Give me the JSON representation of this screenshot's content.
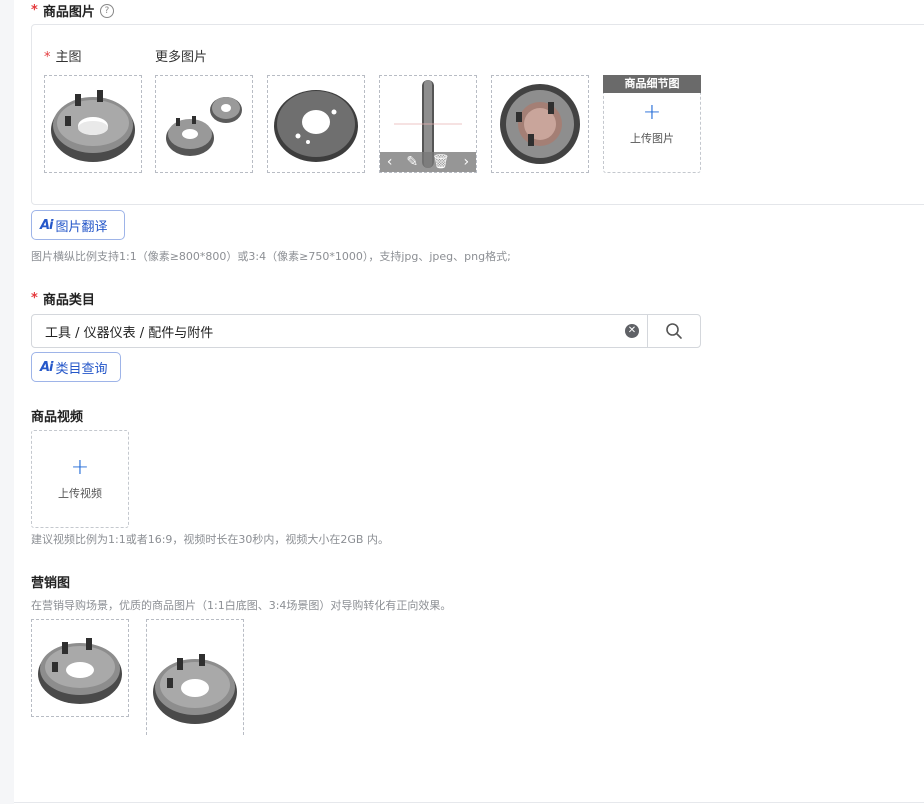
{
  "product_images": {
    "title": "商品图片",
    "main_label": "主图",
    "more_label": "更多图片",
    "detail_tag": "商品细节图",
    "upload_text": "上传图片",
    "hint": "图片横纵比例支持1:1（像素≥800*800）或3:4（像素≥750*1000），支持jpg、jpeg、png格式;",
    "ai_translate": "图片翻译",
    "thumbnails": [
      "flange-plate-main",
      "flange-plate-pair",
      "disk-plate",
      "disk-edge-view",
      "disk-with-pins"
    ],
    "overlay_icons": [
      "chevron-left-icon",
      "edit-icon",
      "trash-icon",
      "chevron-right-icon"
    ]
  },
  "category": {
    "title": "商品类目",
    "value": "工具 / 仪器仪表 / 配件与附件",
    "ai_query": "类目查询"
  },
  "video": {
    "title": "商品视频",
    "upload_text": "上传视频",
    "hint": "建议视频比例为1:1或者16:9，视频时长在30秒内，视频大小在2GB 内。"
  },
  "marketing": {
    "title": "营销图",
    "hint": "在营销导购场景，优质的商品图片（1:1白底图、3:4场景图）对导购转化有正向效果。",
    "images": [
      "marketing-image-square",
      "marketing-image-portrait"
    ]
  },
  "ai_logo": "Ai",
  "required_mark": "*",
  "colors": {
    "accent": "#2557c9",
    "required": "#e4393c",
    "hint": "#8c8f94"
  }
}
